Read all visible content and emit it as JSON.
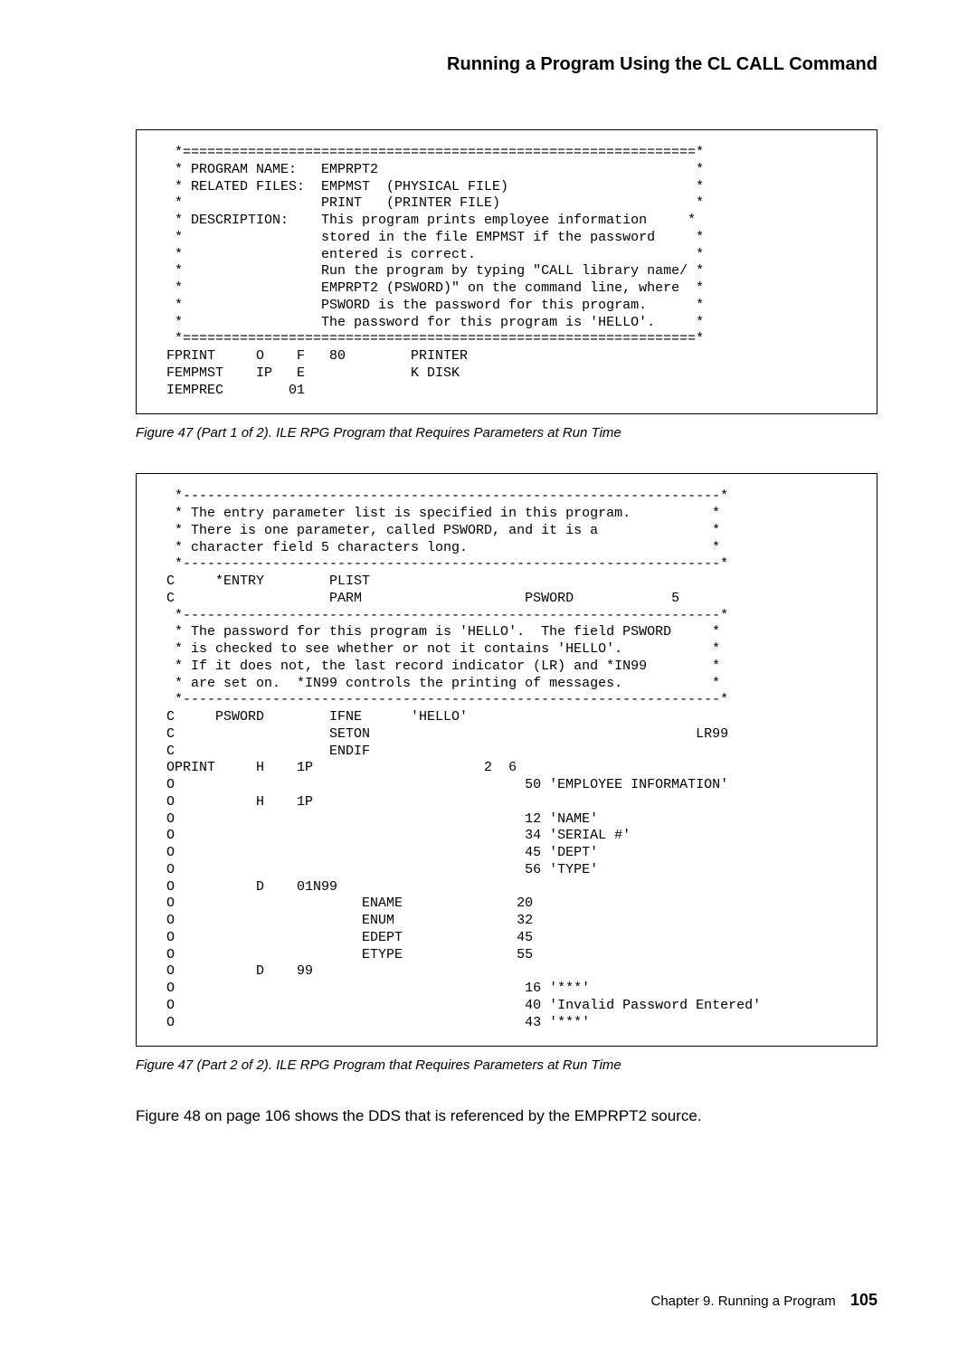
{
  "header": {
    "running_head": "Running a Program Using the CL CALL Command"
  },
  "figure1": {
    "code": "  *===============================================================*\n  * PROGRAM NAME:   EMPRPT2                                       *\n  * RELATED FILES:  EMPMST  (PHYSICAL FILE)                       *\n  *                 PRINT   (PRINTER FILE)                        *\n  * DESCRIPTION:    This program prints employee information     *\n  *                 stored in the file EMPMST if the password     *\n  *                 entered is correct.                           *\n  *                 Run the program by typing \"CALL library name/ *\n  *                 EMPRPT2 (PSWORD)\" on the command line, where  *\n  *                 PSWORD is the password for this program.      *\n  *                 The password for this program is 'HELLO'.     *\n  *===============================================================*\n FPRINT     O    F   80        PRINTER\n FEMPMST    IP   E             K DISK\n IEMPREC        01",
    "caption": "Figure  47 (Part 1 of 2).  ILE RPG Program that Requires Parameters at Run Time"
  },
  "figure2": {
    "code": "  *------------------------------------------------------------------*\n  * The entry parameter list is specified in this program.          *\n  * There is one parameter, called PSWORD, and it is a              *\n  * character field 5 characters long.                              *\n  *------------------------------------------------------------------*\n C     *ENTRY        PLIST\n C                   PARM                    PSWORD            5\n  *------------------------------------------------------------------*\n  * The password for this program is 'HELLO'.  The field PSWORD     *\n  * is checked to see whether or not it contains 'HELLO'.           *\n  * If it does not, the last record indicator (LR) and *IN99        *\n  * are set on.  *IN99 controls the printing of messages.           *\n  *------------------------------------------------------------------*\n C     PSWORD        IFNE      'HELLO'\n C                   SETON                                        LR99\n C                   ENDIF\n OPRINT     H    1P                     2  6\n O                                           50 'EMPLOYEE INFORMATION'\n O          H    1P\n O                                           12 'NAME'\n O                                           34 'SERIAL #'\n O                                           45 'DEPT'\n O                                           56 'TYPE'\n O          D    01N99\n O                       ENAME              20\n O                       ENUM               32\n O                       EDEPT              45\n O                       ETYPE              55\n O          D    99\n O                                           16 '***'\n O                                           40 'Invalid Password Entered'\n O                                           43 '***'",
    "caption": "Figure  47 (Part 2 of 2).  ILE RPG Program that Requires Parameters at Run Time"
  },
  "body": {
    "para1": "Figure  48 on page  106 shows the DDS that is referenced by the EMPRPT2 source."
  },
  "footer": {
    "chapter": "Chapter 9.  Running a Program",
    "page": "105"
  }
}
